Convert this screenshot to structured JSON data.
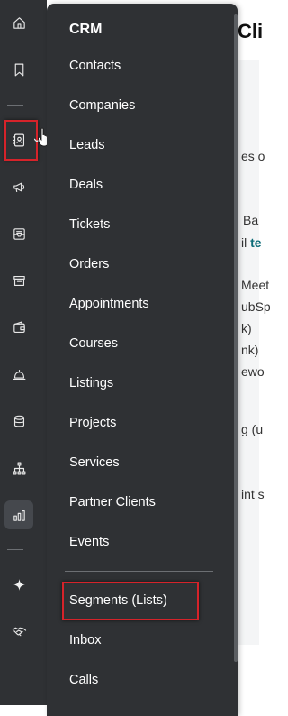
{
  "page": {
    "title_fragment": "Cli",
    "fragments": {
      "f1": "es o",
      "f2": "Ba",
      "f3_prefix": "il",
      "f3_link": "te",
      "f4": "Meet",
      "f5": "ubSp",
      "f6": "k)",
      "f7": "nk)",
      "f8": "ewo",
      "f9": "g (u",
      "f10": "int s"
    }
  },
  "rail": {
    "icons": [
      "home-icon",
      "bookmark-icon",
      "contacts-book-icon",
      "megaphone-icon",
      "inbox-icon",
      "store-icon",
      "wallet-icon",
      "bell-service-icon",
      "database-icon",
      "org-tree-icon",
      "bar-chart-icon",
      "sparkle-icon",
      "handshake-icon"
    ]
  },
  "menu": {
    "title": "CRM",
    "items": [
      "Contacts",
      "Companies",
      "Leads",
      "Deals",
      "Tickets",
      "Orders",
      "Appointments",
      "Courses",
      "Listings",
      "Projects",
      "Services",
      "Partner Clients",
      "Events"
    ],
    "lower_items": [
      "Segments (Lists)",
      "Inbox",
      "Calls"
    ]
  },
  "colors": {
    "sidebar_bg": "#2f3134",
    "highlight_red": "#d6232a",
    "link_teal": "#0b6b77"
  }
}
